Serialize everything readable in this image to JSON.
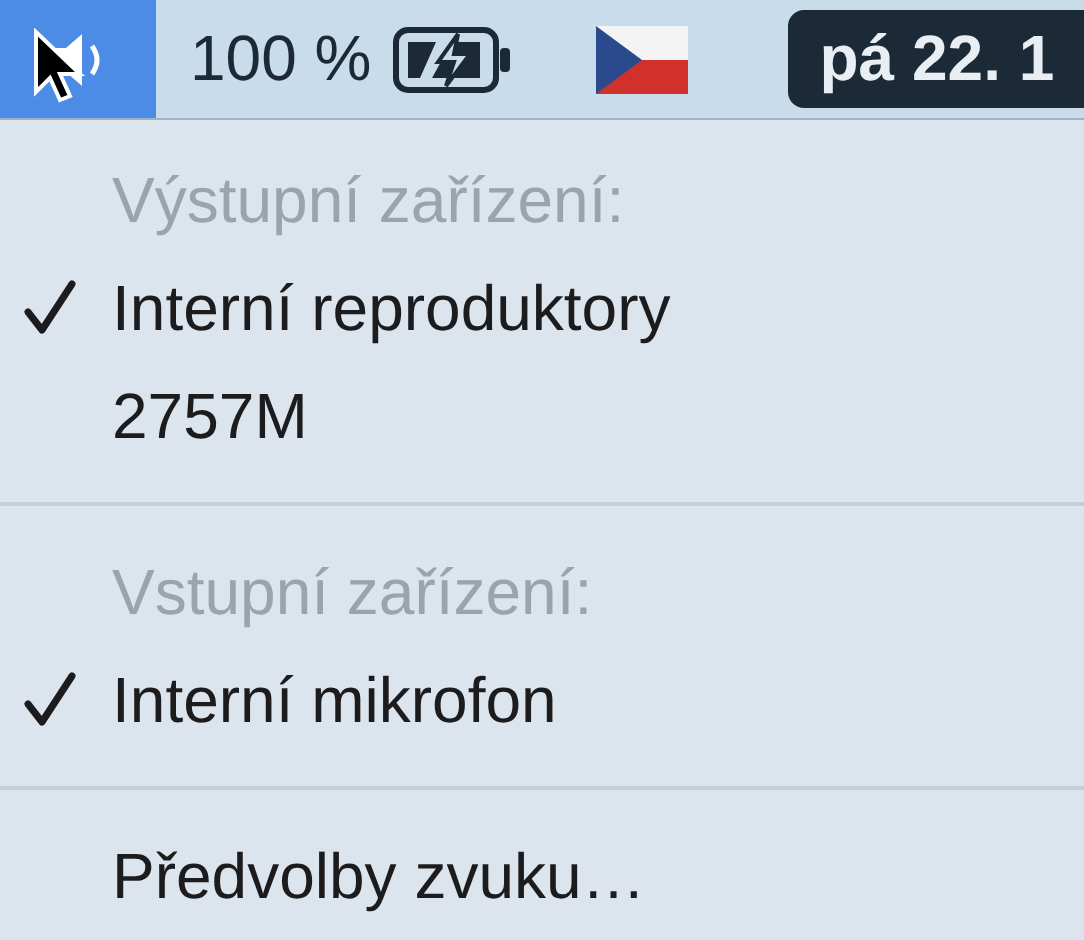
{
  "menu_bar": {
    "volume_selected": true,
    "battery_text": "100 %",
    "date": "pá 22. 1"
  },
  "menu": {
    "sections": [
      {
        "header": "Výstupní zařízení:",
        "items": [
          {
            "label": "Interní reproduktory",
            "checked": true
          },
          {
            "label": "2757M",
            "checked": false
          }
        ]
      },
      {
        "header": "Vstupní zařízení:",
        "items": [
          {
            "label": "Interní mikrofon",
            "checked": true
          }
        ]
      }
    ],
    "footer_item": "Předvolby zvuku…"
  }
}
